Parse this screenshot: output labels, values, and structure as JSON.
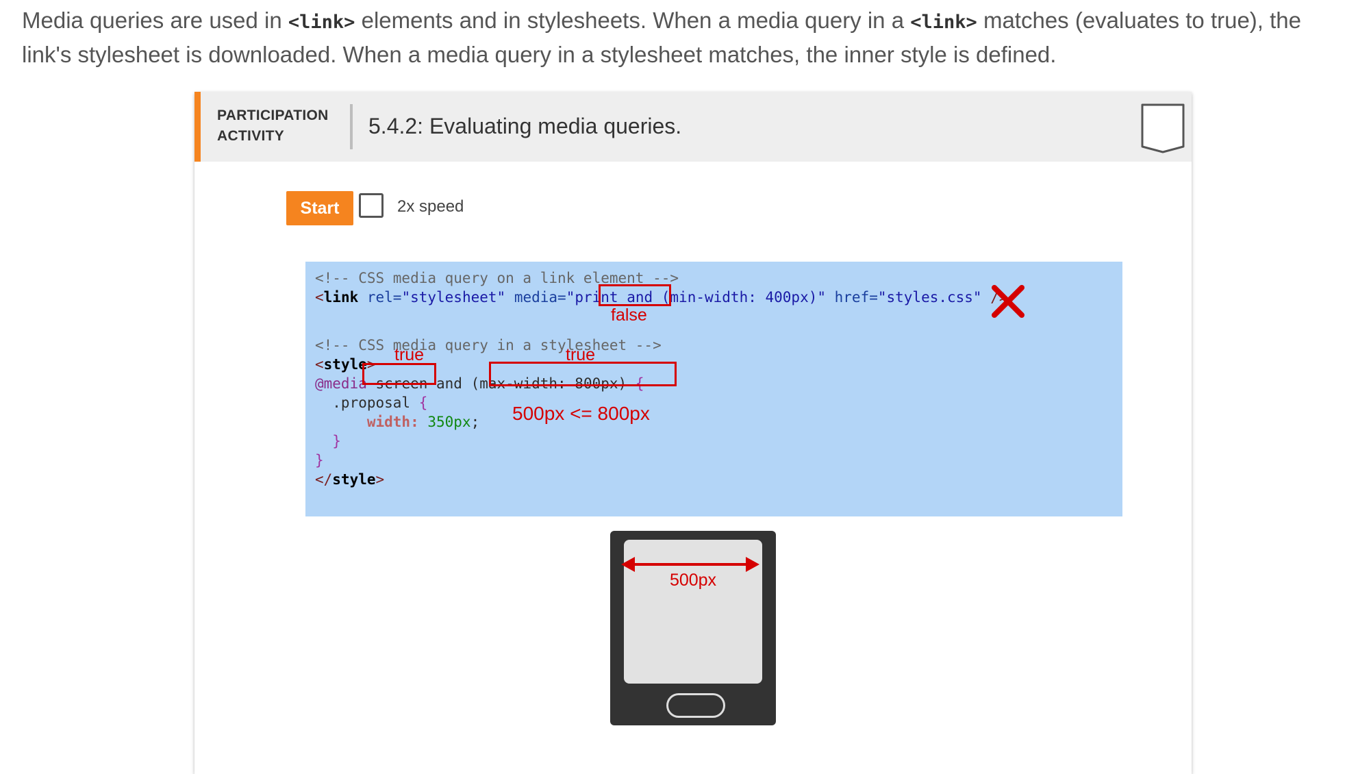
{
  "intro": {
    "t1": "Media queries are used in ",
    "c1": "<link>",
    "t2": " elements and in stylesheets. When a media query in a ",
    "c2": "<link>",
    "t3": " matches (evaluates to true), the link's stylesheet is downloaded. When a media query in a stylesheet matches, the inner style is defined."
  },
  "activity": {
    "kind_line1": "PARTICIPATION",
    "kind_line2": "ACTIVITY",
    "title": "5.4.2: Evaluating media queries.",
    "start_label": "Start",
    "speed_label": "2x speed",
    "speed_checked": false,
    "accent_color": "#f5841f"
  },
  "code": {
    "comment1": "<!-- CSS media query on a link element -->",
    "link_open": "<",
    "link_tag": "link",
    "rel_attr": " rel=",
    "rel_val": "\"stylesheet\"",
    "media_attr": " media=",
    "media_val_print": "\"print ",
    "media_val_rest": "and (min-width: 400px)\"",
    "href_attr": " href=",
    "href_val": "\"styles.css\"",
    "link_close": " />",
    "comment2": "<!-- CSS media query in a stylesheet -->",
    "style_open_lt": "<",
    "style_tag": "style",
    "style_open_gt": ">",
    "at_media": "@media ",
    "media_screen": "screen",
    "media_and": " and ",
    "media_cond": "(max-width: 800px)",
    "brace_open": " {",
    "selector": "  .proposal",
    "sel_brace": " {",
    "prop_indent": "      ",
    "prop_name": "width:",
    "prop_value": " 350px",
    "prop_semi": ";",
    "inner_close": "  }",
    "outer_close": "}",
    "style_close_lt": "</",
    "style_close_tag": "style",
    "style_close_gt": ">"
  },
  "annotations": {
    "print_result": "false",
    "screen_result": "true",
    "maxwidth_result": "true",
    "comparison": "500px <= 800px",
    "x_icon": "red-x-mark"
  },
  "phone": {
    "width_label": "500px"
  }
}
